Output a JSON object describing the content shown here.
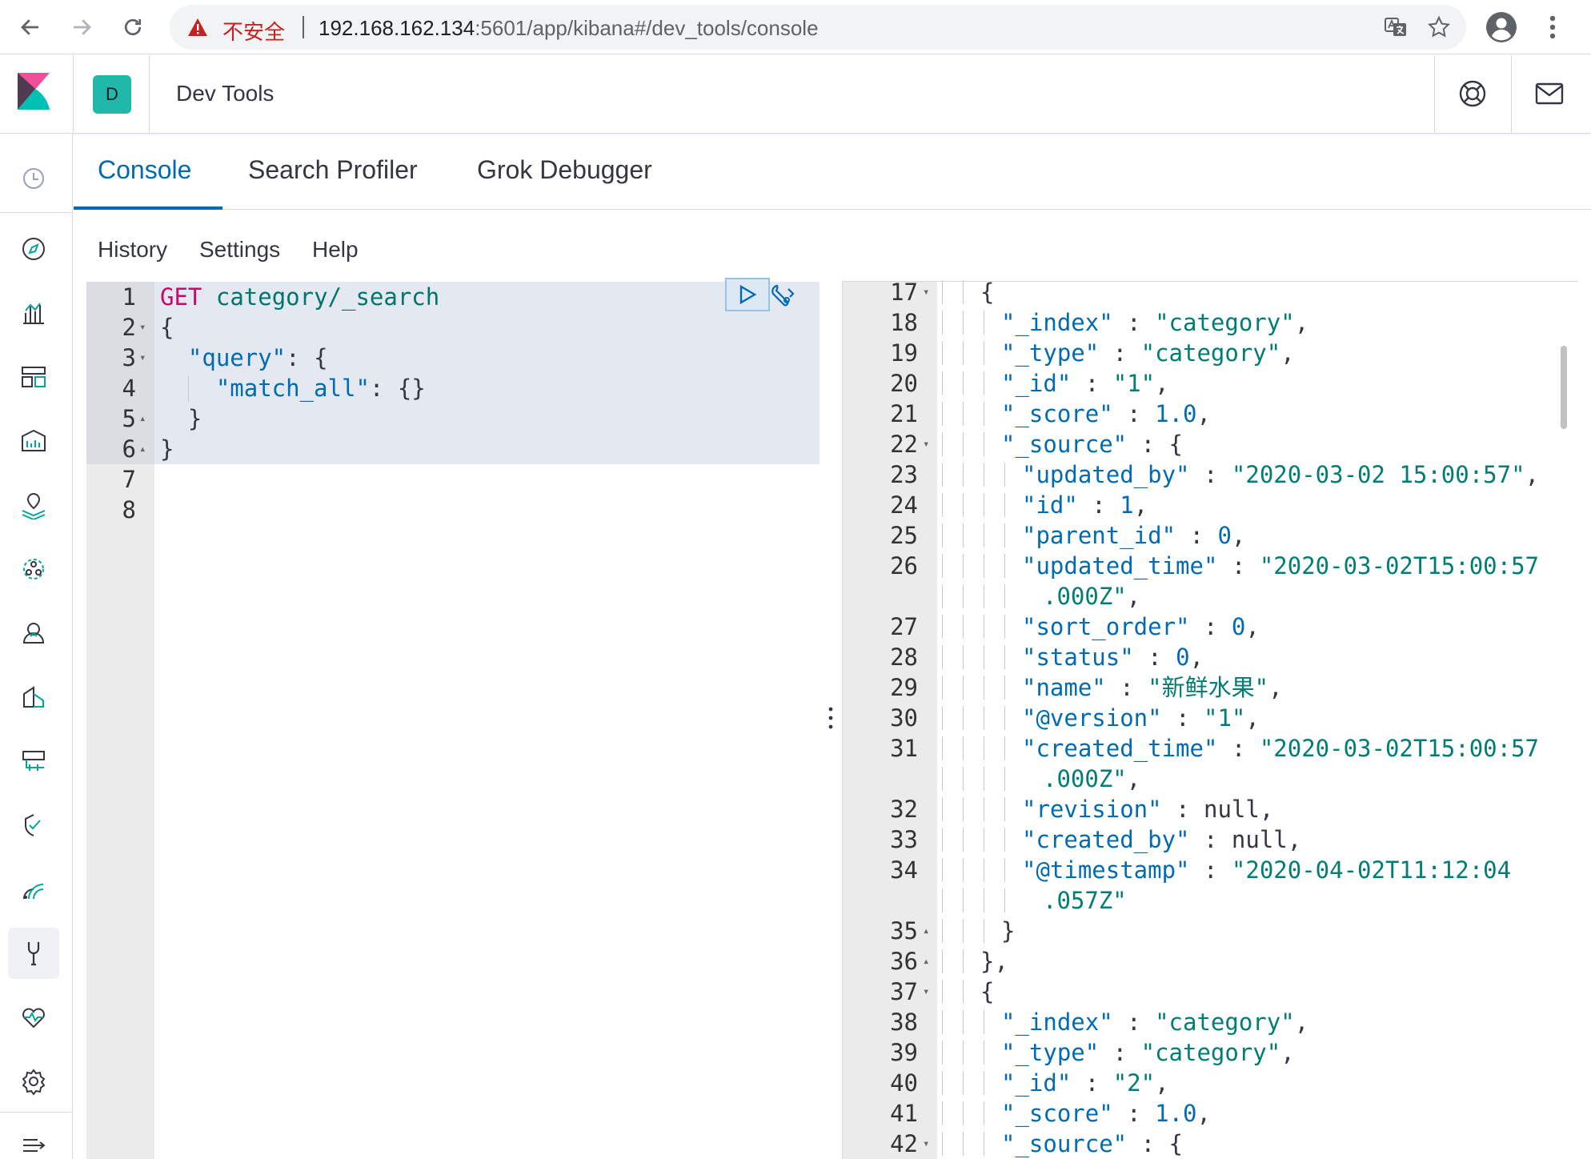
{
  "browser": {
    "insecure_label": "不安全",
    "url_host": "192.168.162.134",
    "url_rest": ":5601/app/kibana#/dev_tools/console"
  },
  "header": {
    "space_initial": "D",
    "title": "Dev Tools"
  },
  "tabs": [
    {
      "label": "Console"
    },
    {
      "label": "Search Profiler"
    },
    {
      "label": "Grok Debugger"
    }
  ],
  "menu": {
    "history": "History",
    "settings": "Settings",
    "help": "Help"
  },
  "editor": {
    "lines": [
      {
        "n": "1",
        "fold": ""
      },
      {
        "n": "2",
        "fold": "▾"
      },
      {
        "n": "3",
        "fold": "▾"
      },
      {
        "n": "4",
        "fold": ""
      },
      {
        "n": "5",
        "fold": "▴"
      },
      {
        "n": "6",
        "fold": "▴"
      },
      {
        "n": "7",
        "fold": ""
      },
      {
        "n": "8",
        "fold": ""
      }
    ],
    "method": "GET",
    "path": "category/_search",
    "open_brace": "{",
    "query_key": "\"query\"",
    "match_all_key": "\"match_all\"",
    "empty_obj": "{}",
    "close_brace": "}"
  },
  "output": {
    "lines": [
      {
        "n": "17",
        "fold": "▾",
        "depth": 2,
        "k": "",
        "sep": "",
        "v": "{",
        "vt": "pun",
        "tail": ""
      },
      {
        "n": "18",
        "fold": "",
        "depth": 3,
        "k": "\"_index\"",
        "sep": " : ",
        "v": "\"category\"",
        "vt": "str",
        "tail": ","
      },
      {
        "n": "19",
        "fold": "",
        "depth": 3,
        "k": "\"_type\"",
        "sep": " : ",
        "v": "\"category\"",
        "vt": "str",
        "tail": ","
      },
      {
        "n": "20",
        "fold": "",
        "depth": 3,
        "k": "\"_id\"",
        "sep": " : ",
        "v": "\"1\"",
        "vt": "str",
        "tail": ","
      },
      {
        "n": "21",
        "fold": "",
        "depth": 3,
        "k": "\"_score\"",
        "sep": " : ",
        "v": "1.0",
        "vt": "num",
        "tail": ","
      },
      {
        "n": "22",
        "fold": "▾",
        "depth": 3,
        "k": "\"_source\"",
        "sep": " : ",
        "v": "{",
        "vt": "pun",
        "tail": ""
      },
      {
        "n": "23",
        "fold": "",
        "depth": 4,
        "k": "\"updated_by\"",
        "sep": " : ",
        "v": "\"2020-03-02 15:00:57\"",
        "vt": "str",
        "tail": ","
      },
      {
        "n": "24",
        "fold": "",
        "depth": 4,
        "k": "\"id\"",
        "sep": " : ",
        "v": "1",
        "vt": "num",
        "tail": ","
      },
      {
        "n": "25",
        "fold": "",
        "depth": 4,
        "k": "\"parent_id\"",
        "sep": " : ",
        "v": "0",
        "vt": "num",
        "tail": ","
      },
      {
        "n": "26",
        "fold": "",
        "depth": 4,
        "k": "\"updated_time\"",
        "sep": " : ",
        "v": "\"2020-03-02T15:00:57",
        "vt": "str",
        "tail": ""
      },
      {
        "n": "",
        "fold": "",
        "depth": 5,
        "k": "",
        "sep": "",
        "v": ".000Z\"",
        "vt": "str",
        "tail": ",",
        "wrap": true
      },
      {
        "n": "27",
        "fold": "",
        "depth": 4,
        "k": "\"sort_order\"",
        "sep": " : ",
        "v": "0",
        "vt": "num",
        "tail": ","
      },
      {
        "n": "28",
        "fold": "",
        "depth": 4,
        "k": "\"status\"",
        "sep": " : ",
        "v": "0",
        "vt": "num",
        "tail": ","
      },
      {
        "n": "29",
        "fold": "",
        "depth": 4,
        "k": "\"name\"",
        "sep": " : ",
        "v": "\"新鲜水果\"",
        "vt": "str",
        "tail": ","
      },
      {
        "n": "30",
        "fold": "",
        "depth": 4,
        "k": "\"@version\"",
        "sep": " : ",
        "v": "\"1\"",
        "vt": "str",
        "tail": ","
      },
      {
        "n": "31",
        "fold": "",
        "depth": 4,
        "k": "\"created_time\"",
        "sep": " : ",
        "v": "\"2020-03-02T15:00:57",
        "vt": "str",
        "tail": ""
      },
      {
        "n": "",
        "fold": "",
        "depth": 5,
        "k": "",
        "sep": "",
        "v": ".000Z\"",
        "vt": "str",
        "tail": ",",
        "wrap": true
      },
      {
        "n": "32",
        "fold": "",
        "depth": 4,
        "k": "\"revision\"",
        "sep": " : ",
        "v": "null",
        "vt": "pun",
        "tail": ","
      },
      {
        "n": "33",
        "fold": "",
        "depth": 4,
        "k": "\"created_by\"",
        "sep": " : ",
        "v": "null",
        "vt": "pun",
        "tail": ","
      },
      {
        "n": "34",
        "fold": "",
        "depth": 4,
        "k": "\"@timestamp\"",
        "sep": " : ",
        "v": "\"2020-04-02T11:12:04",
        "vt": "str",
        "tail": ""
      },
      {
        "n": "",
        "fold": "",
        "depth": 5,
        "k": "",
        "sep": "",
        "v": ".057Z\"",
        "vt": "str",
        "tail": "",
        "wrap": true
      },
      {
        "n": "35",
        "fold": "▴",
        "depth": 3,
        "k": "",
        "sep": "",
        "v": "}",
        "vt": "pun",
        "tail": ""
      },
      {
        "n": "36",
        "fold": "▴",
        "depth": 2,
        "k": "",
        "sep": "",
        "v": "}",
        "vt": "pun",
        "tail": ","
      },
      {
        "n": "37",
        "fold": "▾",
        "depth": 2,
        "k": "",
        "sep": "",
        "v": "{",
        "vt": "pun",
        "tail": ""
      },
      {
        "n": "38",
        "fold": "",
        "depth": 3,
        "k": "\"_index\"",
        "sep": " : ",
        "v": "\"category\"",
        "vt": "str",
        "tail": ","
      },
      {
        "n": "39",
        "fold": "",
        "depth": 3,
        "k": "\"_type\"",
        "sep": " : ",
        "v": "\"category\"",
        "vt": "str",
        "tail": ","
      },
      {
        "n": "40",
        "fold": "",
        "depth": 3,
        "k": "\"_id\"",
        "sep": " : ",
        "v": "\"2\"",
        "vt": "str",
        "tail": ","
      },
      {
        "n": "41",
        "fold": "",
        "depth": 3,
        "k": "\"_score\"",
        "sep": " : ",
        "v": "1.0",
        "vt": "num",
        "tail": ","
      },
      {
        "n": "42",
        "fold": "▾",
        "depth": 3,
        "k": "\"_source\"",
        "sep": " : ",
        "v": "{",
        "vt": "pun",
        "tail": ""
      }
    ]
  },
  "nav_icons": [
    "recent-icon",
    "discover-icon",
    "visualize-icon",
    "dashboard-icon",
    "canvas-icon",
    "maps-icon",
    "machine-learning-icon",
    "uptime-icon",
    "apm-icon",
    "logs-icon",
    "siem-icon",
    "monitoring-icon",
    "dev-tools-icon",
    "stack-monitoring-icon",
    "management-icon",
    "collapse-icon"
  ],
  "colors": {
    "accent": "#006bb4",
    "method": "#c80a68",
    "string": "#017d73",
    "space_avatar": "#20b8a8"
  }
}
